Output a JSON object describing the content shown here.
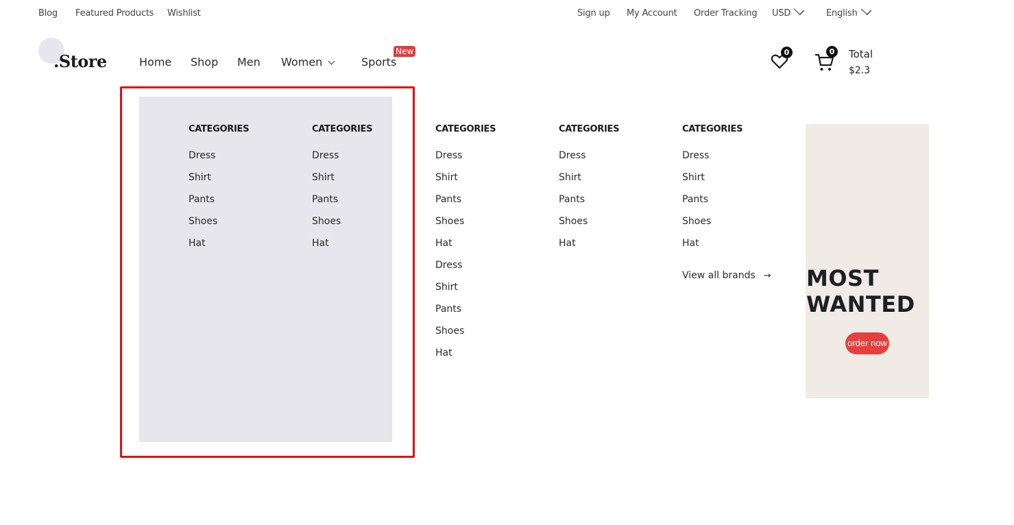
{
  "topbar": {
    "left_links": [
      "Blog",
      "Featured Products",
      "Wishlist"
    ],
    "right_links": [
      "Sign up",
      "My Account",
      "Order Tracking"
    ],
    "currency": "USD",
    "language": "English"
  },
  "header": {
    "logo": ".Store",
    "nav": [
      "Home",
      "Shop",
      "Men",
      "Women",
      "Sports"
    ],
    "new_badge": "New",
    "wishlist_count": "0",
    "cart_count": "0",
    "total_label": "Total",
    "total_value": "$2.3"
  },
  "mega_menu": {
    "columns": [
      {
        "title": "CATEGORIES",
        "items": [
          "Dress",
          "Shirt",
          "Pants",
          "Shoes",
          "Hat"
        ]
      },
      {
        "title": "CATEGORIES",
        "items": [
          "Dress",
          "Shirt",
          "Pants",
          "Shoes",
          "Hat"
        ]
      },
      {
        "title": "CATEGORIES",
        "items": [
          "Dress",
          "Shirt",
          "Pants",
          "Shoes",
          "Hat",
          "Dress",
          "Shirt",
          "Pants",
          "Shoes",
          "Hat"
        ]
      },
      {
        "title": "CATEGORIES",
        "items": [
          "Dress",
          "Shirt",
          "Pants",
          "Shoes",
          "Hat"
        ]
      },
      {
        "title": "CATEGORIES",
        "items": [
          "Dress",
          "Shirt",
          "Pants",
          "Shoes",
          "Hat"
        ]
      }
    ],
    "view_all": "View all brands",
    "promo": {
      "line1": "MOST",
      "line2": "WANTED",
      "button": "order now"
    }
  },
  "colors": {
    "accent": "#e5403f",
    "highlight": "#e01010",
    "panel": "#e7e6ec",
    "promo_bg": "#f0ebe4"
  }
}
